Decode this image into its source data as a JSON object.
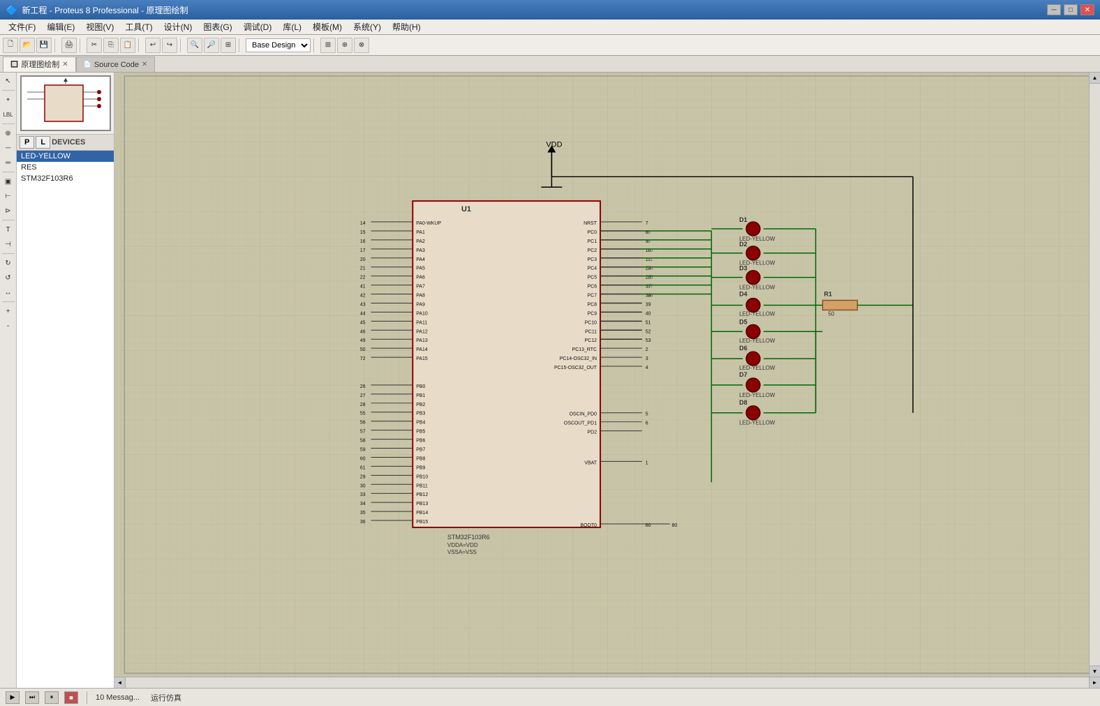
{
  "titlebar": {
    "icon": "★",
    "title": "新工程 - Proteus 8 Professional - 原理图绘制",
    "min_btn": "─",
    "max_btn": "□",
    "close_btn": "✕"
  },
  "menubar": {
    "items": [
      "文件(F)",
      "编辑(E)",
      "视图(V)",
      "工具(T)",
      "设计(N)",
      "图表(G)",
      "调试(D)",
      "库(L)",
      "模板(M)",
      "系统(Y)",
      "帮助(H)"
    ]
  },
  "toolbar": {
    "design_selector": "Base Design",
    "buttons": [
      "new",
      "open",
      "save",
      "print",
      "cut",
      "copy",
      "paste",
      "undo",
      "redo",
      "zoomin",
      "zoomout",
      "zoomall",
      "zoomsel",
      "refresh",
      "run",
      "stop"
    ]
  },
  "tabs": [
    {
      "id": "schematic",
      "label": "原理图绘制",
      "active": true,
      "closable": true
    },
    {
      "id": "sourcecode",
      "label": "Source Code",
      "active": false,
      "closable": true
    }
  ],
  "sidebar": {
    "devices_label": "DEVICES",
    "p_btn": "P",
    "l_btn": "L",
    "device_list": [
      "LED-YELLOW",
      "RES",
      "STM32F103R6"
    ],
    "selected_device": "LED-YELLOW"
  },
  "circuit": {
    "ic_label": "U1",
    "ic_part": "STM32F103R6",
    "ic_sub1": "VDDA=VDD",
    "ic_sub2": "VSSA=VSS",
    "vdd_label": "VDD",
    "resistor_label": "R1",
    "resistor_value": "50",
    "leds": [
      "D1",
      "D2",
      "D3",
      "D4",
      "D5",
      "D6",
      "D7",
      "D8"
    ],
    "led_type": "LED-YELLOW",
    "left_pins": [
      {
        "num": "14",
        "name": "PA0-WKUP"
      },
      {
        "num": "15",
        "name": "PA1"
      },
      {
        "num": "16",
        "name": "PA2"
      },
      {
        "num": "17",
        "name": "PA3"
      },
      {
        "num": "20",
        "name": "PA4"
      },
      {
        "num": "21",
        "name": "PA5"
      },
      {
        "num": "22",
        "name": "PA6"
      },
      {
        "num": "41",
        "name": "PA7"
      },
      {
        "num": "42",
        "name": "PA8"
      },
      {
        "num": "43",
        "name": "PA9"
      },
      {
        "num": "44",
        "name": "PA10"
      },
      {
        "num": "45",
        "name": "PA11"
      },
      {
        "num": "46",
        "name": "PA12"
      },
      {
        "num": "49",
        "name": "PA13"
      },
      {
        "num": "50",
        "name": "PA14"
      },
      {
        "num": "72",
        "name": "PA15"
      }
    ],
    "right_pins": [
      {
        "num": "7",
        "name": "NRST"
      },
      {
        "num": "8",
        "name": "PC0"
      },
      {
        "num": "9",
        "name": "PC1"
      },
      {
        "num": "10",
        "name": "PC2"
      },
      {
        "num": "11",
        "name": "PC3"
      },
      {
        "num": "24",
        "name": "PC4"
      },
      {
        "num": "25",
        "name": "PC5"
      },
      {
        "num": "37",
        "name": "PC6"
      },
      {
        "num": "38",
        "name": "PC7"
      },
      {
        "num": "39",
        "name": "PC8"
      },
      {
        "num": "40",
        "name": "PC9"
      },
      {
        "num": "51",
        "name": "PC10"
      },
      {
        "num": "52",
        "name": "PC11"
      },
      {
        "num": "53",
        "name": "PC12"
      },
      {
        "num": "2",
        "name": "PC13_RTC"
      },
      {
        "num": "3",
        "name": "PC14-OSC32_IN"
      },
      {
        "num": "4",
        "name": "PC15-OSC32_OUT"
      }
    ],
    "bottom_left_pins": [
      {
        "num": "26",
        "name": "PB0"
      },
      {
        "num": "27",
        "name": "PB1"
      },
      {
        "num": "28",
        "name": "PB2"
      },
      {
        "num": "55",
        "name": "PB3"
      },
      {
        "num": "56",
        "name": "PB4"
      },
      {
        "num": "57",
        "name": "PB5"
      },
      {
        "num": "58",
        "name": "PB6"
      },
      {
        "num": "59",
        "name": "PB7"
      },
      {
        "num": "60",
        "name": "PB8"
      },
      {
        "num": "61",
        "name": "PB9"
      },
      {
        "num": "29",
        "name": "PB10"
      },
      {
        "num": "30",
        "name": "PB11"
      },
      {
        "num": "33",
        "name": "PB12"
      },
      {
        "num": "34",
        "name": "PB13"
      },
      {
        "num": "35",
        "name": "PB14"
      },
      {
        "num": "36",
        "name": "PB15"
      }
    ],
    "bottom_right_pins": [
      {
        "num": "5",
        "name": "OSCIN_PD0"
      },
      {
        "num": "6",
        "name": "OSCOUT_PD1"
      },
      {
        "num": "",
        "name": "PD2"
      },
      {
        "num": "1",
        "name": "VBAT"
      },
      {
        "num": ""
      },
      {
        "num": "80",
        "name": "BOOT0"
      }
    ]
  },
  "statusbar": {
    "messages": "10 Messag...",
    "simulation": "运行仿真"
  }
}
